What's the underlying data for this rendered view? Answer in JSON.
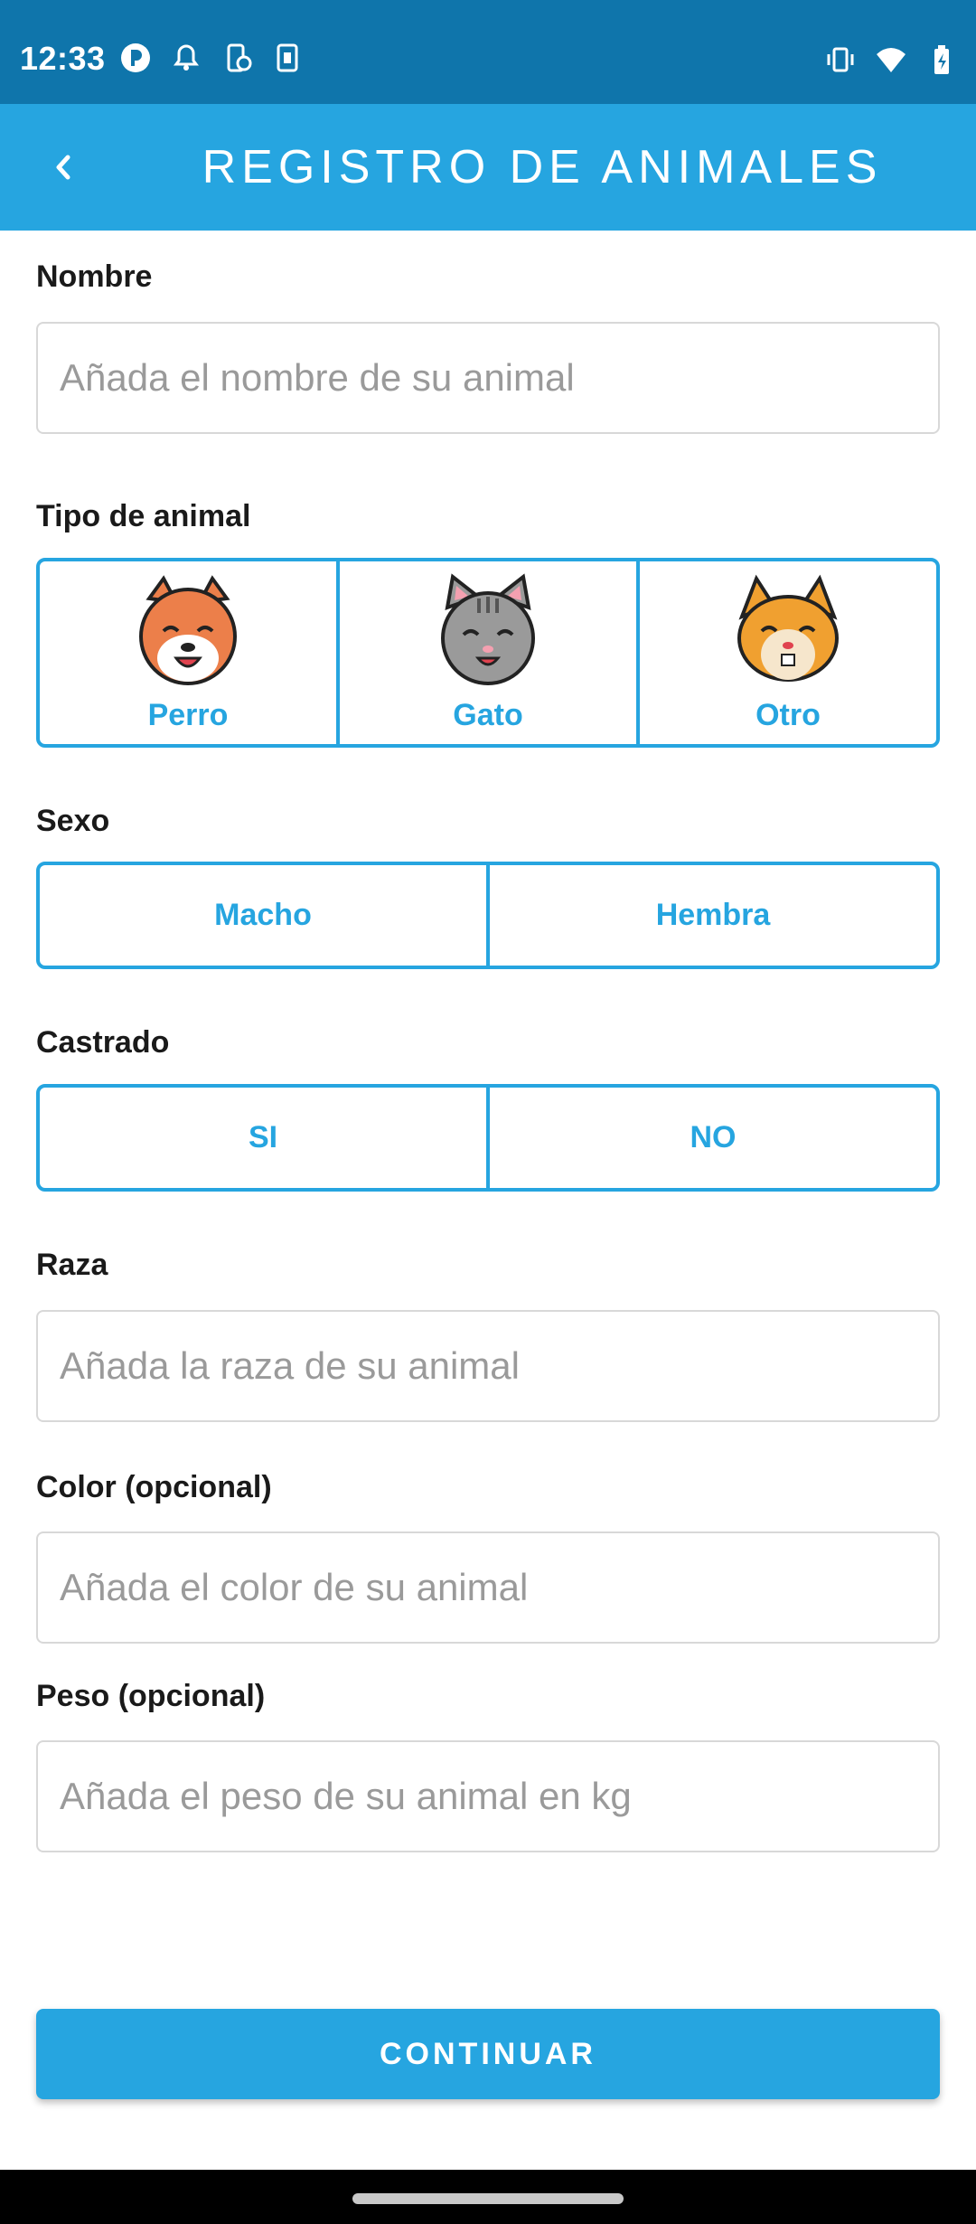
{
  "status_bar": {
    "time": "12:33",
    "left_icons": [
      "app-notification-icon",
      "bell-icon",
      "phone-sync-icon",
      "sim-card-icon"
    ],
    "right_icons": [
      "vibrate-icon",
      "wifi-icon",
      "battery-charging-icon"
    ]
  },
  "app_bar": {
    "title": "REGISTRO DE ANIMALES",
    "back_icon": "chevron-left-icon",
    "color": "#26a5e0"
  },
  "form": {
    "nombre": {
      "label": "Nombre",
      "placeholder": "Añada el nombre de su animal",
      "value": ""
    },
    "tipo": {
      "label": "Tipo de animal",
      "options": [
        {
          "label": "Perro",
          "icon": "dog-icon"
        },
        {
          "label": "Gato",
          "icon": "cat-icon"
        },
        {
          "label": "Otro",
          "icon": "hamster-icon"
        }
      ]
    },
    "sexo": {
      "label": "Sexo",
      "options": [
        "Macho",
        "Hembra"
      ]
    },
    "castrado": {
      "label": "Castrado",
      "options": [
        "SI",
        "NO"
      ]
    },
    "raza": {
      "label": "Raza",
      "placeholder": "Añada la raza de su animal",
      "value": ""
    },
    "color": {
      "label": "Color (opcional)",
      "placeholder": "Añada el color de su animal",
      "value": ""
    },
    "peso": {
      "label": "Peso (opcional)",
      "placeholder": "Añada el peso de su animal en kg",
      "value": ""
    }
  },
  "continue_label": "CONTINUAR",
  "colors": {
    "status_bar": "#0f75ab",
    "accent": "#26a5e0",
    "input_border": "#d8d8d8",
    "placeholder": "#9a9a9a"
  }
}
